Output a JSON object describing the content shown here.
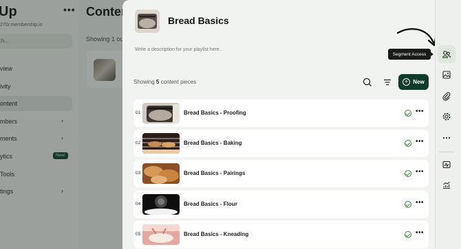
{
  "background": {
    "app_title": "Up",
    "menu_dots": "•••",
    "url": "270r.membership.io",
    "search_placeholder": "ch...",
    "nav": [
      {
        "label": "view"
      },
      {
        "label": "ivity"
      },
      {
        "label": "ontent",
        "active": true
      },
      {
        "label": "mbers",
        "chevron": "›"
      },
      {
        "label": "ments",
        "chevron": "›"
      },
      {
        "label": "ytics",
        "badge": "New!"
      },
      {
        "label": "Tools"
      },
      {
        "label": "tings",
        "chevron": "›"
      }
    ],
    "main_title": "Conten",
    "showing": "Showing 1 out"
  },
  "modal": {
    "playlist_title": "Bread Basics",
    "description_placeholder": "Write a description for your playlist here..",
    "showing_prefix": "Showing",
    "showing_count": "5",
    "showing_suffix": "content pieces",
    "new_button": "New",
    "tooltip": "Segment Access",
    "close_icon": "close-icon"
  },
  "rail": [
    {
      "name": "segment-access-icon",
      "active": true
    },
    {
      "name": "image-icon"
    },
    {
      "name": "attachment-icon"
    },
    {
      "name": "settings-icon"
    },
    {
      "name": "more-icon"
    },
    {
      "name": "analytics-icon"
    },
    {
      "name": "trend-icon"
    }
  ],
  "items": [
    {
      "num": "01",
      "title": "Bread Basics - Proofing",
      "status": "published"
    },
    {
      "num": "02",
      "title": "Bread Basics - Baking",
      "status": "published"
    },
    {
      "num": "03",
      "title": "Bread Basics - Pairings",
      "status": "published"
    },
    {
      "num": "04",
      "title": "Bread Basics - Flour",
      "status": "published"
    },
    {
      "num": "05",
      "title": "Bread Basics - Kneading",
      "status": "published"
    }
  ],
  "colors": {
    "accent": "#0f3b2b",
    "success": "#3f8a3c",
    "rail_active": "#dfe8dd"
  }
}
